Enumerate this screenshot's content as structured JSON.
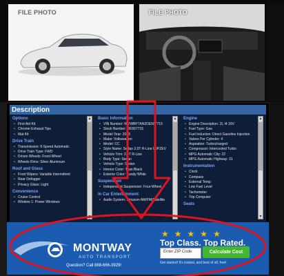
{
  "photos": {
    "exterior_label": "FILE PHOTO",
    "interior_label": "FILE PHOTO"
  },
  "description": {
    "title": "Description",
    "col1": [
      {
        "heading": "Options",
        "items": [
          "First Aid Kit",
          "Chrome Exhaust Tips",
          "Mat Kit"
        ]
      },
      {
        "heading": "Drive Train",
        "items": [
          "Transmission: 6-Speed Automatic",
          "Drive Train Type: FWD",
          "Driven Wheels: Front-Wheel",
          "Wheels Rims: Silver Aluminum"
        ]
      },
      {
        "heading": "Roof and Glass",
        "items": [
          "Front Wipers: Variable Intermittent",
          "Rear Defogger",
          "Privacy Glass: Light"
        ]
      },
      {
        "heading": "Convenience",
        "items": [
          "Cruise Control",
          "Window 1: Power Windows"
        ]
      }
    ],
    "col2": [
      {
        "heading": "Basic Information",
        "items": [
          "VIN Number: WVWBP7AN2DE567715",
          "Stock Number: DE567715",
          "Model Year: 2013",
          "Make: Volkswagen",
          "Model: CC",
          "Style Name: Sedan 2.0T R-Line W/PZEV",
          "Vehicle Trim: 2.0T R-Line",
          "Body Type: Sedan",
          "Vehicle Type: Sedan",
          "Interior Color: Titan Black",
          "Exterior Color: Candy White"
        ]
      },
      {
        "heading": "Suspension",
        "items": [
          "Independent Suspension: Four-Wheel"
        ]
      },
      {
        "heading": "In Car Entertainment",
        "items": [
          "Audio System: Siriusxm AM/FM/Satellite"
        ]
      }
    ],
    "col3": [
      {
        "heading": "Engine",
        "items": [
          "Engine Description: 2L I4 16V",
          "Fuel Type: Gas",
          "Fuel Induction: Direct Gasoline Injection",
          "Valves Per Cylinder: 4",
          "Aspiration: Turbocharged",
          "Compressor: Intercooled Turbo",
          "MPG Automatic City: 22",
          "MPG Automatic Highway: 31"
        ]
      },
      {
        "heading": "Instrumentation",
        "items": [
          "Clock",
          "Compass",
          "External Temp",
          "Low Fuel Level",
          "Tachometer",
          "Trip Computer"
        ]
      },
      {
        "heading": "Seats",
        "items": []
      }
    ]
  },
  "ad": {
    "brand": "MONTWAY",
    "brand_sub": "AUTO TRANSPORT",
    "question": "Question? Call 888-666-3929!",
    "tagline": "Top Class. Top Rated.",
    "zip_placeholder": "Enter ZIP Code",
    "cta_label": "Calculate Cost",
    "get_started": "Get started! It's instant, and best of all, free!",
    "stars": [
      "★",
      "★",
      "★",
      "★",
      "★"
    ]
  },
  "colors": {
    "section_header": "#3566a6",
    "ad_background": "#1b5cb0",
    "cta": "#46b52f",
    "annotation": "#e0141e"
  }
}
